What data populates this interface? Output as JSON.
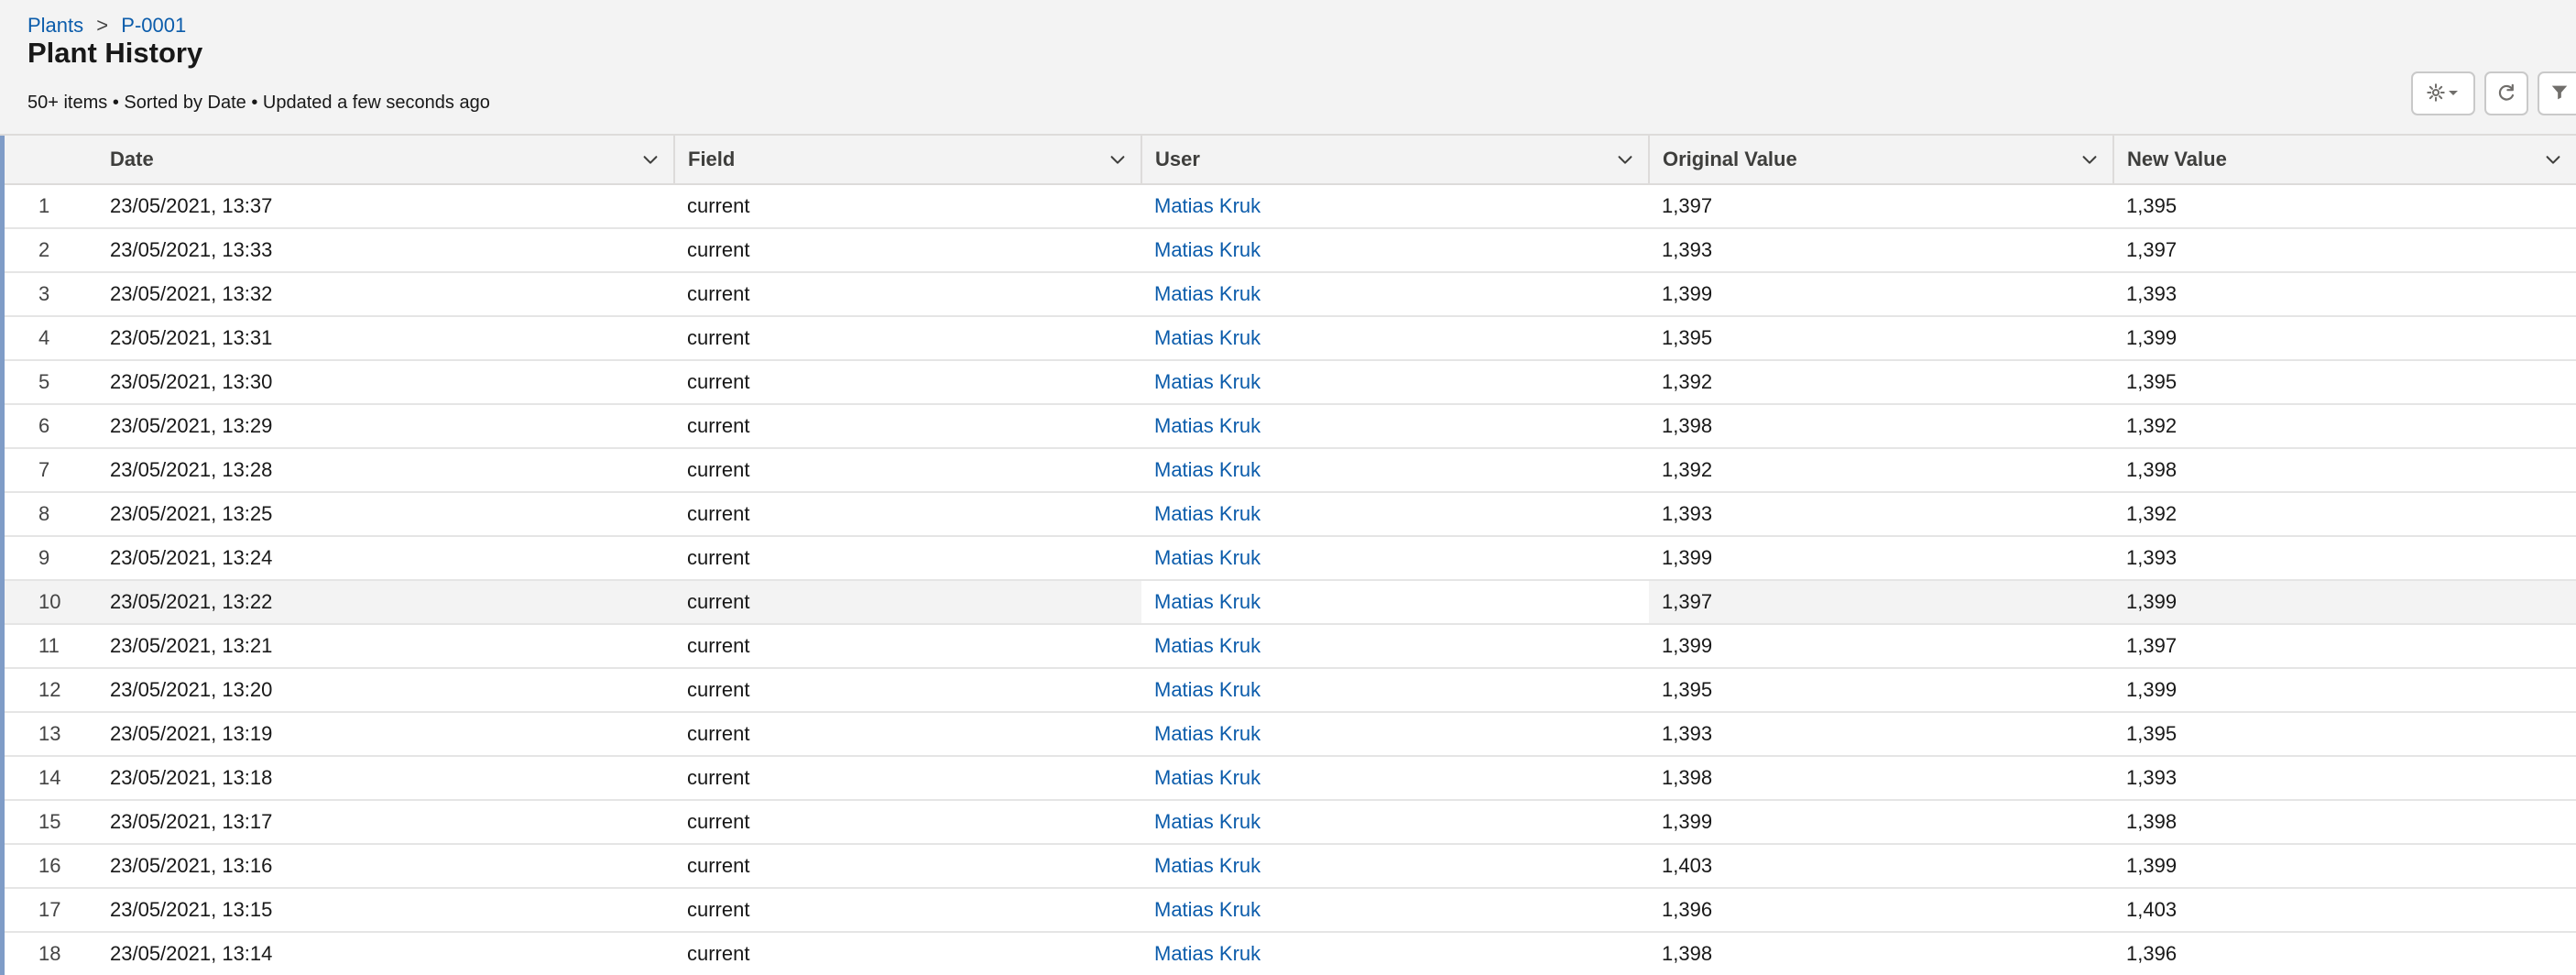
{
  "breadcrumb": {
    "parent": "Plants",
    "separator": ">",
    "current": "P-0001"
  },
  "page": {
    "title": "Plant History",
    "status": "50+ items • Sorted by Date • Updated a few seconds ago"
  },
  "toolbar": {
    "settings_icon": "gear-icon",
    "settings_caret_icon": "caret-down-icon",
    "refresh_icon": "refresh-icon",
    "filter_icon": "filter-icon"
  },
  "table": {
    "columns": [
      "Date",
      "Field",
      "User",
      "Original Value",
      "New Value"
    ],
    "rows": [
      {
        "index": "1",
        "date": "23/05/2021, 13:37",
        "field": "current",
        "user": "Matias Kruk",
        "original_value": "1,397",
        "new_value": "1,395"
      },
      {
        "index": "2",
        "date": "23/05/2021, 13:33",
        "field": "current",
        "user": "Matias Kruk",
        "original_value": "1,393",
        "new_value": "1,397"
      },
      {
        "index": "3",
        "date": "23/05/2021, 13:32",
        "field": "current",
        "user": "Matias Kruk",
        "original_value": "1,399",
        "new_value": "1,393"
      },
      {
        "index": "4",
        "date": "23/05/2021, 13:31",
        "field": "current",
        "user": "Matias Kruk",
        "original_value": "1,395",
        "new_value": "1,399"
      },
      {
        "index": "5",
        "date": "23/05/2021, 13:30",
        "field": "current",
        "user": "Matias Kruk",
        "original_value": "1,392",
        "new_value": "1,395"
      },
      {
        "index": "6",
        "date": "23/05/2021, 13:29",
        "field": "current",
        "user": "Matias Kruk",
        "original_value": "1,398",
        "new_value": "1,392"
      },
      {
        "index": "7",
        "date": "23/05/2021, 13:28",
        "field": "current",
        "user": "Matias Kruk",
        "original_value": "1,392",
        "new_value": "1,398"
      },
      {
        "index": "8",
        "date": "23/05/2021, 13:25",
        "field": "current",
        "user": "Matias Kruk",
        "original_value": "1,393",
        "new_value": "1,392"
      },
      {
        "index": "9",
        "date": "23/05/2021, 13:24",
        "field": "current",
        "user": "Matias Kruk",
        "original_value": "1,399",
        "new_value": "1,393"
      },
      {
        "index": "10",
        "date": "23/05/2021, 13:22",
        "field": "current",
        "user": "Matias Kruk",
        "original_value": "1,397",
        "new_value": "1,399"
      },
      {
        "index": "11",
        "date": "23/05/2021, 13:21",
        "field": "current",
        "user": "Matias Kruk",
        "original_value": "1,399",
        "new_value": "1,397"
      },
      {
        "index": "12",
        "date": "23/05/2021, 13:20",
        "field": "current",
        "user": "Matias Kruk",
        "original_value": "1,395",
        "new_value": "1,399"
      },
      {
        "index": "13",
        "date": "23/05/2021, 13:19",
        "field": "current",
        "user": "Matias Kruk",
        "original_value": "1,393",
        "new_value": "1,395"
      },
      {
        "index": "14",
        "date": "23/05/2021, 13:18",
        "field": "current",
        "user": "Matias Kruk",
        "original_value": "1,398",
        "new_value": "1,393"
      },
      {
        "index": "15",
        "date": "23/05/2021, 13:17",
        "field": "current",
        "user": "Matias Kruk",
        "original_value": "1,399",
        "new_value": "1,398"
      },
      {
        "index": "16",
        "date": "23/05/2021, 13:16",
        "field": "current",
        "user": "Matias Kruk",
        "original_value": "1,403",
        "new_value": "1,399"
      },
      {
        "index": "17",
        "date": "23/05/2021, 13:15",
        "field": "current",
        "user": "Matias Kruk",
        "original_value": "1,396",
        "new_value": "1,403"
      },
      {
        "index": "18",
        "date": "23/05/2021, 13:14",
        "field": "current",
        "user": "Matias Kruk",
        "original_value": "1,398",
        "new_value": "1,396"
      }
    ]
  }
}
